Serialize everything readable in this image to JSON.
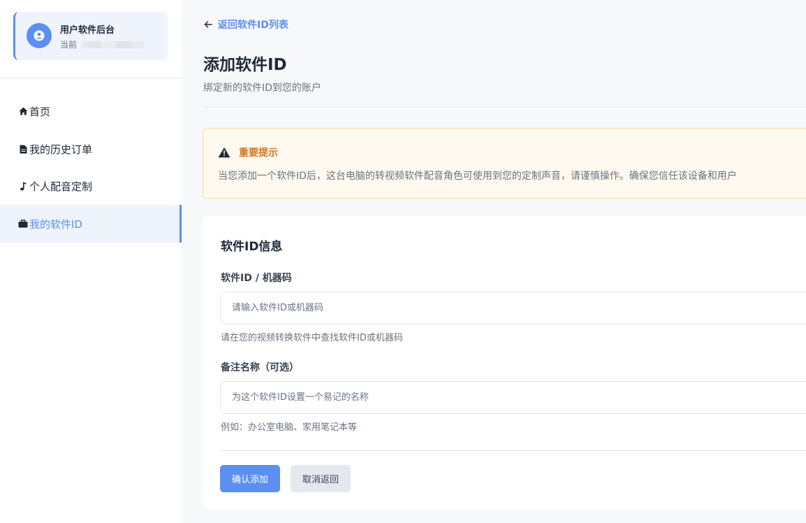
{
  "sidebar": {
    "user_card": {
      "title": "用户软件后台",
      "subtitle_prefix": "当前"
    },
    "items": [
      {
        "label": "首页",
        "icon": "home-icon"
      },
      {
        "label": "我的历史订单",
        "icon": "document-icon"
      },
      {
        "label": "个人配音定制",
        "icon": "music-note-icon"
      },
      {
        "label": "我的软件ID",
        "icon": "briefcase-icon",
        "active": true
      }
    ]
  },
  "header": {
    "back_label": "返回软件ID列表",
    "title": "添加软件ID",
    "subtitle": "绑定新的软件ID到您的账户"
  },
  "notice": {
    "title": "重要提示",
    "body": "当您添加一个软件ID后，这台电脑的转视频软件配音角色可使用到您的定制声音，请谨慎操作。确保您信任该设备和用户"
  },
  "form": {
    "title": "软件ID信息",
    "software_id": {
      "label": "软件ID / 机器码",
      "placeholder": "请输入软件ID或机器码",
      "help": "请在您的视频转换软件中查找软件ID或机器码"
    },
    "note_name": {
      "label": "备注名称（可选）",
      "placeholder": "为这个软件ID设置一个易记的名称",
      "help": "例如：办公室电脑、家用笔记本等"
    },
    "confirm_label": "确认添加",
    "cancel_label": "取消返回"
  },
  "colors": {
    "accent": "#5b8ff0",
    "warning": "#d9731f",
    "warning_bg": "#fff9ef"
  }
}
